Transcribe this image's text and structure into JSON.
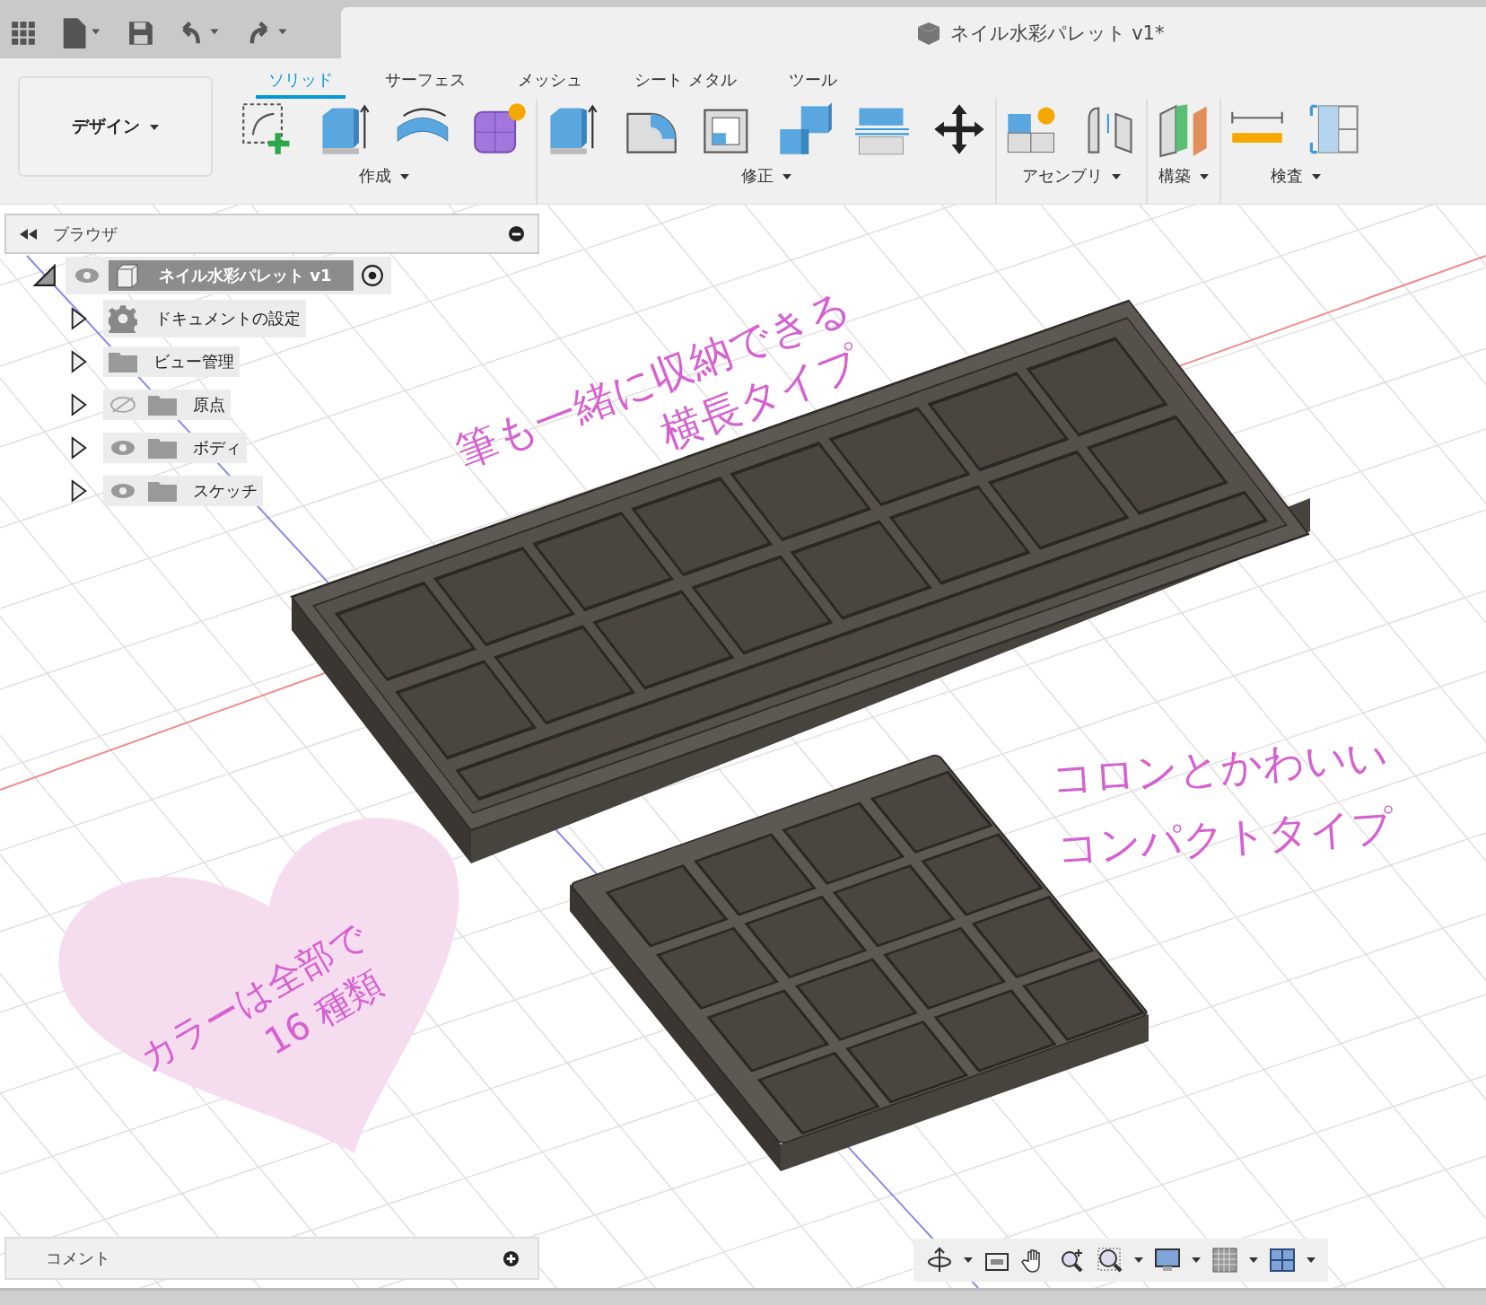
{
  "window": {
    "title": "ネイル水彩パレット v1*"
  },
  "workspace": {
    "label": "デザイン"
  },
  "tabs": [
    {
      "label": "ソリッド",
      "selected": true
    },
    {
      "label": "サーフェス",
      "selected": false
    },
    {
      "label": "メッシュ",
      "selected": false
    },
    {
      "label": "シート メタル",
      "selected": false
    },
    {
      "label": "ツール",
      "selected": false
    }
  ],
  "tool_groups": [
    {
      "label": "作成"
    },
    {
      "label": "修正"
    },
    {
      "label": "アセンブリ"
    },
    {
      "label": "構築"
    },
    {
      "label": "検査"
    }
  ],
  "browser": {
    "title": "ブラウザ",
    "tree": [
      {
        "label": "ネイル水彩パレット v1",
        "kind": "component",
        "visible": true,
        "expanded": true,
        "children": [
          {
            "label": "ドキュメントの設定",
            "kind": "settings",
            "expanded": false
          },
          {
            "label": "ビュー管理",
            "kind": "plain-folder",
            "expanded": false
          },
          {
            "label": "原点",
            "kind": "folder",
            "visible": false,
            "expanded": false
          },
          {
            "label": "ボディ",
            "kind": "folder",
            "visible": true,
            "expanded": false
          },
          {
            "label": "スケッチ",
            "kind": "folder",
            "visible": true,
            "expanded": false
          }
        ]
      }
    ]
  },
  "annotations": [
    {
      "kind": "text",
      "lines": [
        "筆も一緒に収納できる",
        "横長タイプ"
      ]
    },
    {
      "kind": "text",
      "lines": [
        "コロンとかわいい",
        "コンパクトタイプ"
      ]
    },
    {
      "kind": "heart",
      "lines": [
        "カラーは全部で",
        "16 種類"
      ]
    }
  ],
  "comments": {
    "title": "コメント"
  }
}
